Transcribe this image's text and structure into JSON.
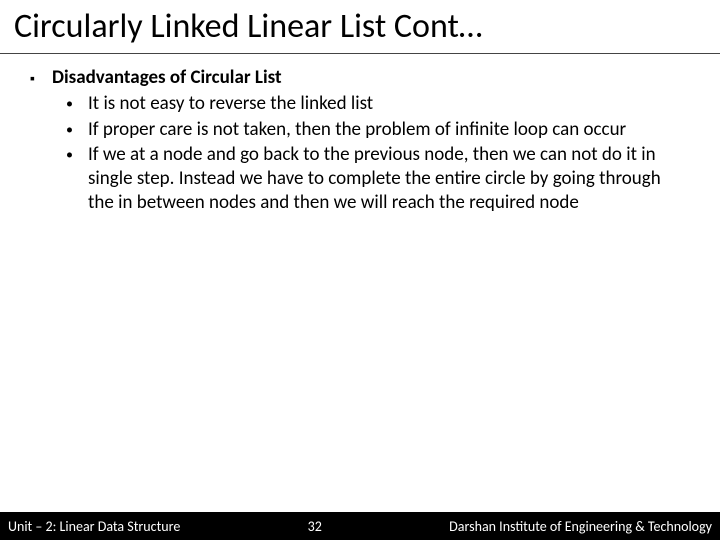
{
  "title": "Circularly Linked Linear List Cont…",
  "bullets": [
    {
      "text": "Disadvantages of Circular List",
      "sub": [
        "It is not easy to reverse the linked list",
        "If proper care is not taken, then the problem of infinite loop can occur",
        "If we at a node and go back to the previous node, then we can not do it in single step. Instead we have to complete the entire circle by going through the in between nodes and then we will reach the required node"
      ]
    }
  ],
  "footer": {
    "left": "Unit – 2: Linear Data Structure",
    "page": "32",
    "right": "Darshan Institute of Engineering & Technology"
  }
}
